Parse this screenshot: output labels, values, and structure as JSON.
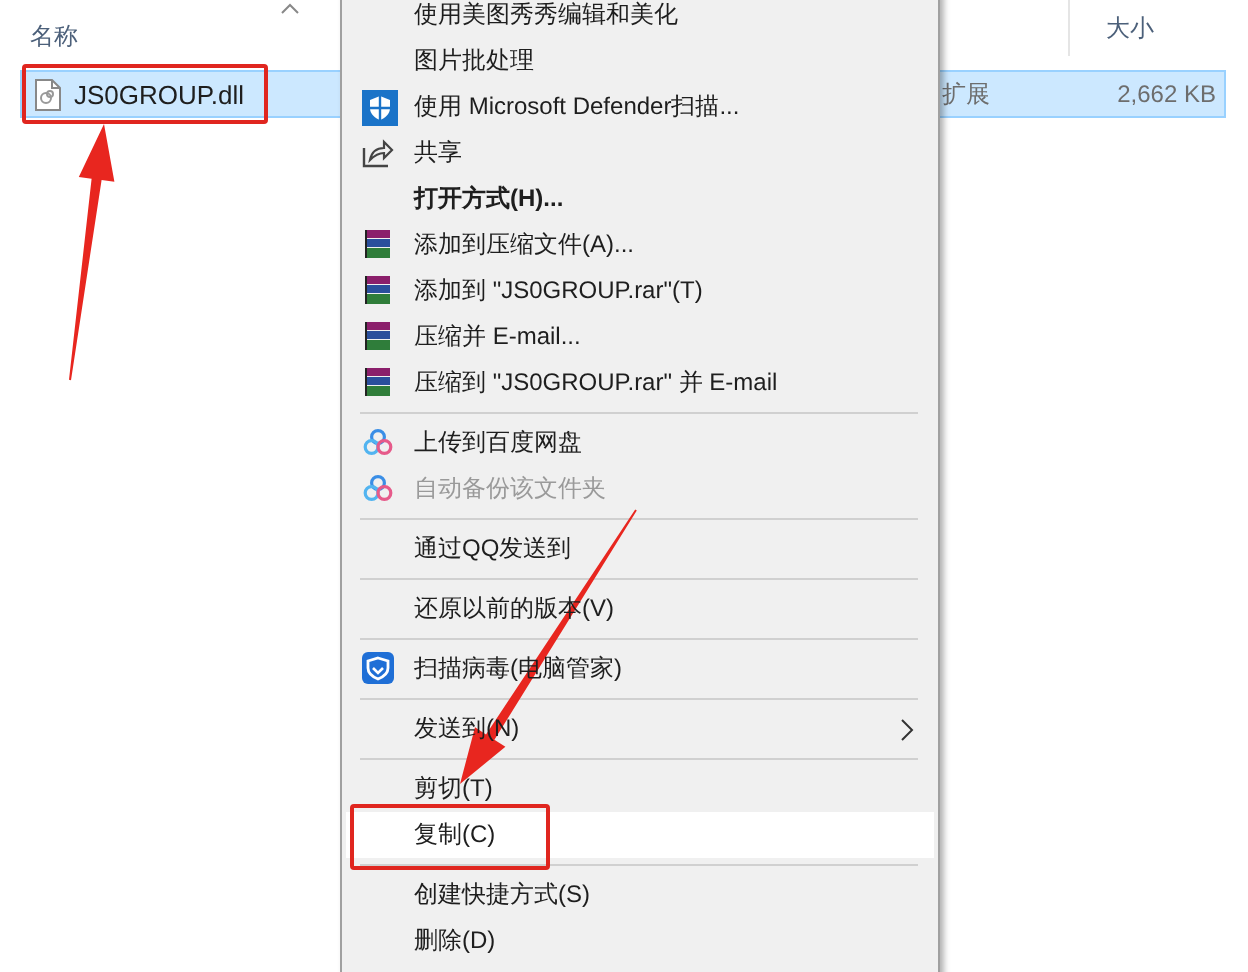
{
  "explorer": {
    "columns": [
      {
        "label": "名称"
      },
      {
        "label": "大小"
      }
    ],
    "files": [
      {
        "name": "JS0GROUP.dll",
        "type": "扩展",
        "size": "2,662 KB",
        "selected": true
      }
    ]
  },
  "context_menu": {
    "groups": [
      [
        {
          "label": "使用美图秀秀编辑和美化",
          "kind": "plain",
          "bold": false,
          "disabled": false,
          "submenu": false,
          "selected": false
        },
        {
          "label": "图片批处理",
          "kind": "plain",
          "bold": false,
          "disabled": false,
          "submenu": false,
          "selected": false
        },
        {
          "label": "使用 Microsoft Defender扫描...",
          "kind": "defender",
          "bold": false,
          "disabled": false,
          "submenu": false,
          "selected": false
        },
        {
          "label": "共享",
          "kind": "share",
          "bold": false,
          "disabled": false,
          "submenu": false,
          "selected": false
        },
        {
          "label": "打开方式(H)...",
          "kind": "plain",
          "bold": true,
          "disabled": false,
          "submenu": false,
          "selected": false
        },
        {
          "label": "添加到压缩文件(A)...",
          "kind": "archive",
          "bold": false,
          "disabled": false,
          "submenu": false,
          "selected": false
        },
        {
          "label": "添加到 \"JS0GROUP.rar\"(T)",
          "kind": "archive",
          "bold": false,
          "disabled": false,
          "submenu": false,
          "selected": false
        },
        {
          "label": "压缩并 E-mail...",
          "kind": "archive",
          "bold": false,
          "disabled": false,
          "submenu": false,
          "selected": false
        },
        {
          "label": "压缩到 \"JS0GROUP.rar\" 并 E-mail",
          "kind": "archive",
          "bold": false,
          "disabled": false,
          "submenu": false,
          "selected": false
        }
      ],
      [
        {
          "label": "上传到百度网盘",
          "kind": "cloud",
          "bold": false,
          "disabled": false,
          "submenu": false,
          "selected": false
        },
        {
          "label": "自动备份该文件夹",
          "kind": "cloud",
          "bold": false,
          "disabled": true,
          "submenu": false,
          "selected": false
        }
      ],
      [
        {
          "label": "通过QQ发送到",
          "kind": "plain",
          "bold": false,
          "disabled": false,
          "submenu": false,
          "selected": false
        }
      ],
      [
        {
          "label": "还原以前的版本(V)",
          "kind": "plain",
          "bold": false,
          "disabled": false,
          "submenu": false,
          "selected": false
        }
      ],
      [
        {
          "label": "扫描病毒(电脑管家)",
          "kind": "guard",
          "bold": false,
          "disabled": false,
          "submenu": false,
          "selected": false
        }
      ],
      [
        {
          "label": "发送到(N)",
          "kind": "plain",
          "bold": false,
          "disabled": false,
          "submenu": true,
          "selected": false
        }
      ],
      [
        {
          "label": "剪切(T)",
          "kind": "plain",
          "bold": false,
          "disabled": false,
          "submenu": false,
          "selected": false
        },
        {
          "label": "复制(C)",
          "kind": "plain",
          "bold": false,
          "disabled": false,
          "submenu": false,
          "selected": true
        }
      ],
      [
        {
          "label": "创建快捷方式(S)",
          "kind": "plain",
          "bold": false,
          "disabled": false,
          "submenu": false,
          "selected": false
        },
        {
          "label": "删除(D)",
          "kind": "plain",
          "bold": false,
          "disabled": false,
          "submenu": false,
          "selected": false
        }
      ]
    ]
  }
}
